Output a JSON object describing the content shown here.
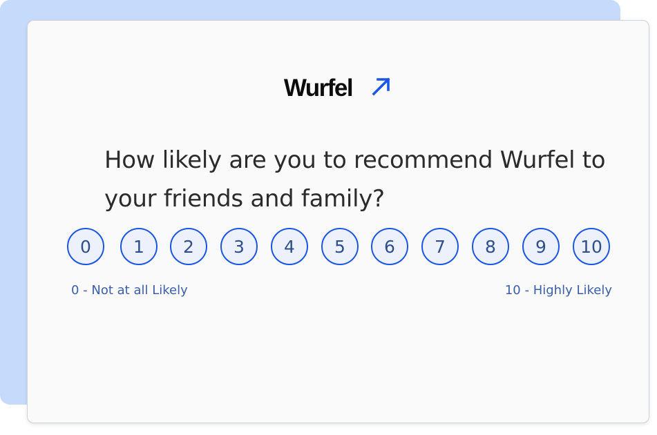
{
  "brand": {
    "name": "Wurfel",
    "icon": "arrow-up-right-icon",
    "accent_color": "#1a55e3"
  },
  "survey": {
    "question": "How likely are you to recommend Wurfel to your friends and family?",
    "scores": [
      "0",
      "1",
      "2",
      "3",
      "4",
      "5",
      "6",
      "7",
      "8",
      "9",
      "10"
    ],
    "low_label": "0 - Not at all Likely",
    "high_label": "10 - Highly Likely"
  },
  "colors": {
    "backdrop": "#c6dafc",
    "card": "#fafafa",
    "score_border": "#1a55e3",
    "score_fill": "#ecf1fb",
    "score_text": "#2e4e8d"
  }
}
